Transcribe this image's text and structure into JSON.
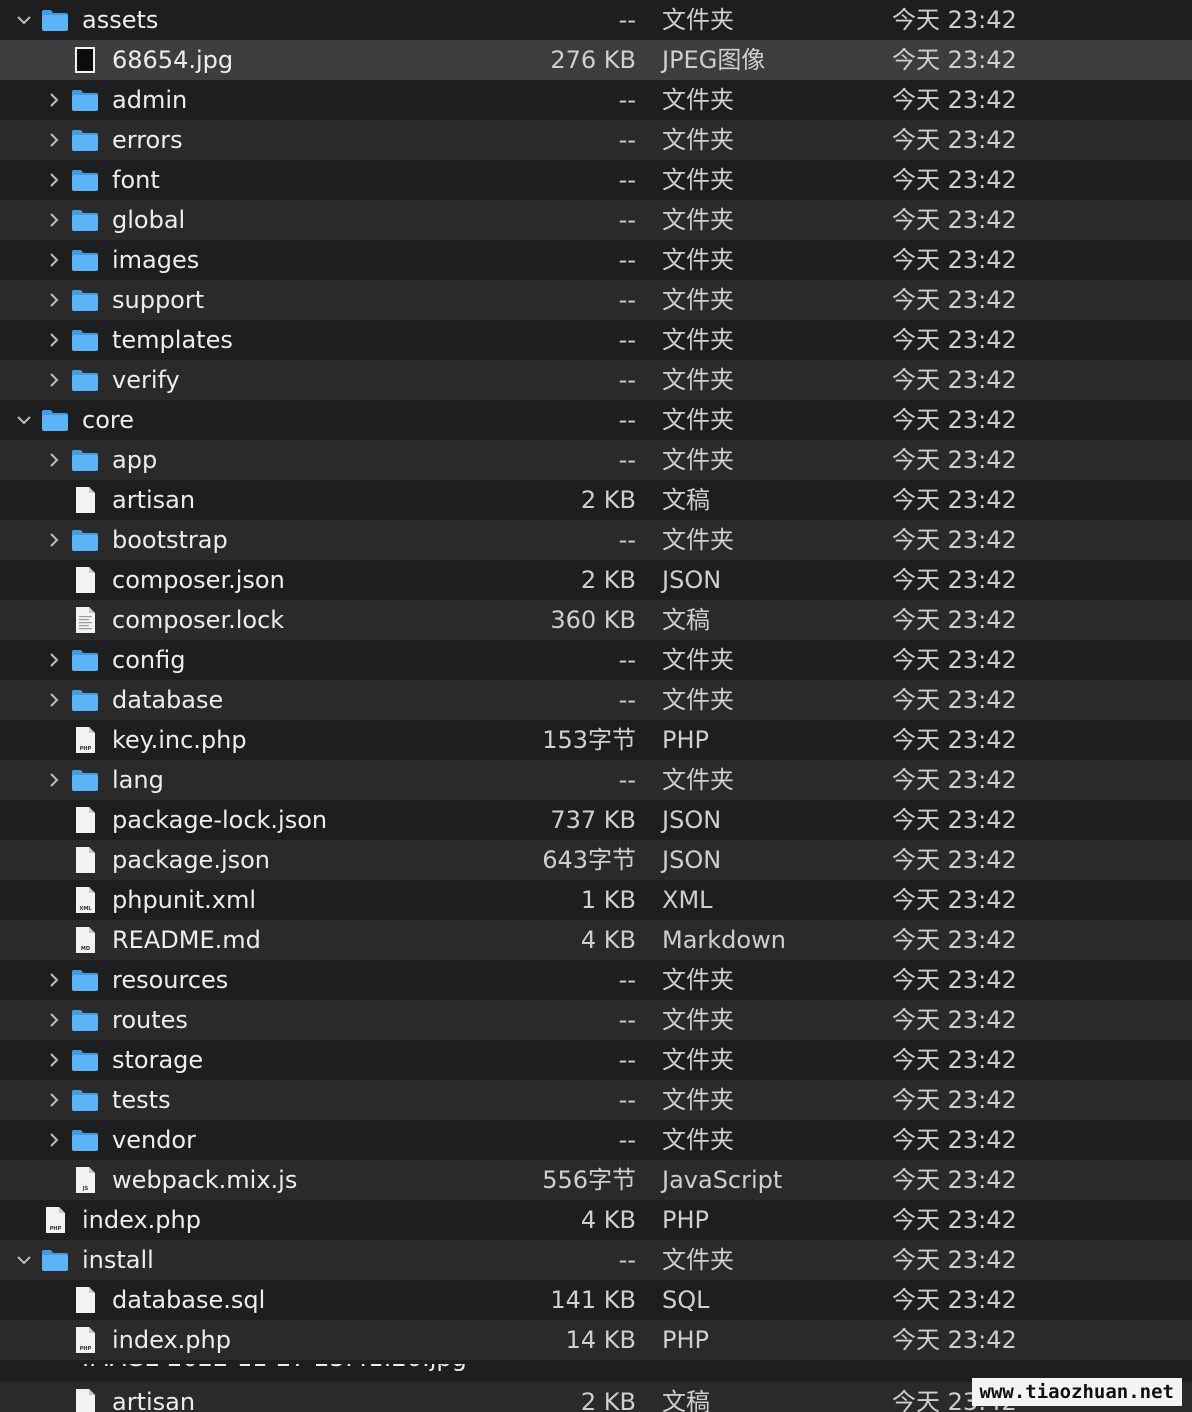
{
  "rows": [
    {
      "name": "assets",
      "size": "--",
      "kind": "文件夹",
      "date": "今天 23:42",
      "type": "folder",
      "indent": 0,
      "expanded": true
    },
    {
      "name": "68654.jpg",
      "size": "276 KB",
      "kind": "JPEG图像",
      "date": "今天 23:42",
      "type": "image",
      "indent": 1,
      "selected": true
    },
    {
      "name": "admin",
      "size": "--",
      "kind": "文件夹",
      "date": "今天 23:42",
      "type": "folder",
      "indent": 1,
      "expanded": false
    },
    {
      "name": "errors",
      "size": "--",
      "kind": "文件夹",
      "date": "今天 23:42",
      "type": "folder",
      "indent": 1,
      "expanded": false
    },
    {
      "name": "font",
      "size": "--",
      "kind": "文件夹",
      "date": "今天 23:42",
      "type": "folder",
      "indent": 1,
      "expanded": false
    },
    {
      "name": "global",
      "size": "--",
      "kind": "文件夹",
      "date": "今天 23:42",
      "type": "folder",
      "indent": 1,
      "expanded": false
    },
    {
      "name": "images",
      "size": "--",
      "kind": "文件夹",
      "date": "今天 23:42",
      "type": "folder",
      "indent": 1,
      "expanded": false
    },
    {
      "name": "support",
      "size": "--",
      "kind": "文件夹",
      "date": "今天 23:42",
      "type": "folder",
      "indent": 1,
      "expanded": false
    },
    {
      "name": "templates",
      "size": "--",
      "kind": "文件夹",
      "date": "今天 23:42",
      "type": "folder",
      "indent": 1,
      "expanded": false
    },
    {
      "name": "verify",
      "size": "--",
      "kind": "文件夹",
      "date": "今天 23:42",
      "type": "folder",
      "indent": 1,
      "expanded": false
    },
    {
      "name": "core",
      "size": "--",
      "kind": "文件夹",
      "date": "今天 23:42",
      "type": "folder",
      "indent": 0,
      "expanded": true
    },
    {
      "name": "app",
      "size": "--",
      "kind": "文件夹",
      "date": "今天 23:42",
      "type": "folder",
      "indent": 1,
      "expanded": false
    },
    {
      "name": "artisan",
      "size": "2 KB",
      "kind": "文稿",
      "date": "今天 23:42",
      "type": "doc",
      "indent": 1
    },
    {
      "name": "bootstrap",
      "size": "--",
      "kind": "文件夹",
      "date": "今天 23:42",
      "type": "folder",
      "indent": 1,
      "expanded": false
    },
    {
      "name": "composer.json",
      "size": "2 KB",
      "kind": "JSON",
      "date": "今天 23:42",
      "type": "doc",
      "indent": 1
    },
    {
      "name": "composer.lock",
      "size": "360 KB",
      "kind": "文稿",
      "date": "今天 23:42",
      "type": "text",
      "indent": 1
    },
    {
      "name": "config",
      "size": "--",
      "kind": "文件夹",
      "date": "今天 23:42",
      "type": "folder",
      "indent": 1,
      "expanded": false
    },
    {
      "name": "database",
      "size": "--",
      "kind": "文件夹",
      "date": "今天 23:42",
      "type": "folder",
      "indent": 1,
      "expanded": false
    },
    {
      "name": "key.inc.php",
      "size": "153字节",
      "kind": "PHP",
      "date": "今天 23:42",
      "type": "tagged",
      "tag": "PHP",
      "indent": 1
    },
    {
      "name": "lang",
      "size": "--",
      "kind": "文件夹",
      "date": "今天 23:42",
      "type": "folder",
      "indent": 1,
      "expanded": false
    },
    {
      "name": "package-lock.json",
      "size": "737 KB",
      "kind": "JSON",
      "date": "今天 23:42",
      "type": "doc",
      "indent": 1
    },
    {
      "name": "package.json",
      "size": "643字节",
      "kind": "JSON",
      "date": "今天 23:42",
      "type": "doc",
      "indent": 1
    },
    {
      "name": "phpunit.xml",
      "size": "1 KB",
      "kind": "XML",
      "date": "今天 23:42",
      "type": "tagged",
      "tag": "XML",
      "indent": 1
    },
    {
      "name": "README.md",
      "size": "4 KB",
      "kind": "Markdown",
      "date": "今天 23:42",
      "type": "tagged",
      "tag": "MD",
      "indent": 1
    },
    {
      "name": "resources",
      "size": "--",
      "kind": "文件夹",
      "date": "今天 23:42",
      "type": "folder",
      "indent": 1,
      "expanded": false
    },
    {
      "name": "routes",
      "size": "--",
      "kind": "文件夹",
      "date": "今天 23:42",
      "type": "folder",
      "indent": 1,
      "expanded": false
    },
    {
      "name": "storage",
      "size": "--",
      "kind": "文件夹",
      "date": "今天 23:42",
      "type": "folder",
      "indent": 1,
      "expanded": false
    },
    {
      "name": "tests",
      "size": "--",
      "kind": "文件夹",
      "date": "今天 23:42",
      "type": "folder",
      "indent": 1,
      "expanded": false
    },
    {
      "name": "vendor",
      "size": "--",
      "kind": "文件夹",
      "date": "今天 23:42",
      "type": "folder",
      "indent": 1,
      "expanded": false
    },
    {
      "name": "webpack.mix.js",
      "size": "556字节",
      "kind": "JavaScript",
      "date": "今天 23:42",
      "type": "tagged",
      "tag": "JS",
      "indent": 1
    },
    {
      "name": "index.php",
      "size": "4 KB",
      "kind": "PHP",
      "date": "今天 23:42",
      "type": "tagged",
      "tag": "PHP",
      "indent": 0
    },
    {
      "name": "install",
      "size": "--",
      "kind": "文件夹",
      "date": "今天 23:42",
      "type": "folder",
      "indent": 0,
      "expanded": true
    },
    {
      "name": "database.sql",
      "size": "141 KB",
      "kind": "SQL",
      "date": "今天 23:42",
      "type": "doc",
      "indent": 1
    },
    {
      "name": "index.php",
      "size": "14 KB",
      "kind": "PHP",
      "date": "今天 23:42",
      "type": "tagged",
      "tag": "PHP",
      "indent": 1
    }
  ],
  "last_row": {
    "name": "artisan",
    "size": "2 KB",
    "kind": "文稿",
    "date": "今天 23:42",
    "type": "doc",
    "indent": 1
  },
  "watermark": "www.tiaozhuan.net",
  "colors": {
    "folder": "#5ab4f5",
    "folder_tab": "#3f9ce8",
    "background": "#1e1e1e",
    "stripe": "#2a2a2a",
    "selected": "#3d3d3f"
  }
}
